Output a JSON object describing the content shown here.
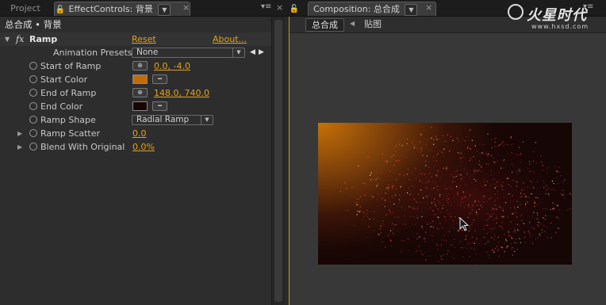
{
  "left_tabs": {
    "project_label": "Project",
    "effect_controls_label": "EffectControls: 背景"
  },
  "right_tabs": {
    "composition_label": "Composition: 总合成"
  },
  "effect_controls": {
    "breadcrumb": "总合成 • 背景",
    "effect_name": "Ramp",
    "fx_symbol": "fx",
    "reset_label": "Reset",
    "about_label": "About...",
    "presets_label": "Animation Presets:",
    "presets_value": "None",
    "properties": [
      {
        "label": "Start of Ramp",
        "value": "0.0, -4.0",
        "kind": "point"
      },
      {
        "label": "Start Color",
        "color": "#c46a0c",
        "kind": "color"
      },
      {
        "label": "End of Ramp",
        "value": "148.0, 740.0",
        "kind": "point"
      },
      {
        "label": "End Color",
        "color": "#170404",
        "kind": "color"
      },
      {
        "label": "Ramp Shape",
        "value": "Radial Ramp",
        "kind": "select"
      },
      {
        "label": "Ramp Scatter",
        "value": "0.0",
        "kind": "number"
      },
      {
        "label": "Blend With Original",
        "value": "0.0%",
        "kind": "number"
      }
    ]
  },
  "composition": {
    "comp_tab": "总合成",
    "layer_crumb": "贴图"
  },
  "watermark": {
    "title": "火星时代",
    "url": "www.hxsd.com"
  },
  "colors": {
    "accent": "#e3a21c",
    "panel_bg": "#2d2d2d",
    "active_border": "#c99a20"
  }
}
